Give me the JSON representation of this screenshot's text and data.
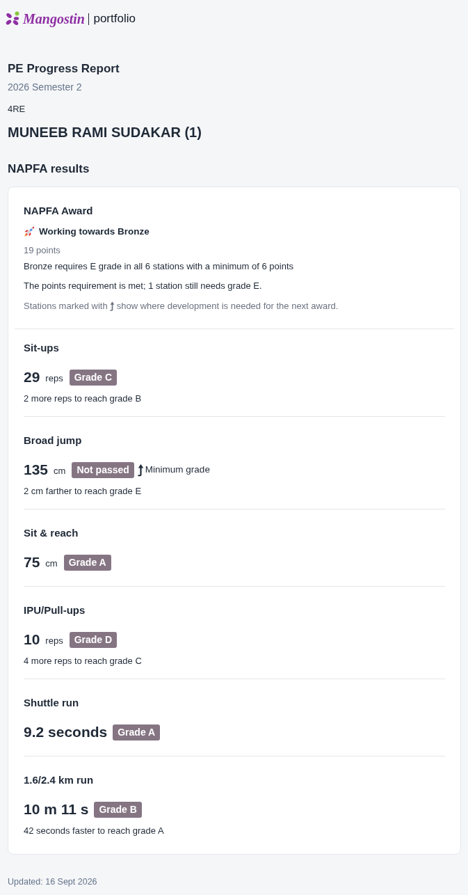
{
  "header": {
    "brand": "Mangostin",
    "product": "portfolio"
  },
  "report": {
    "title": "PE Progress Report",
    "term": "2026 Semester 2",
    "class": "4RE",
    "student": "MUNEEB RAMI SUDAKAR (1)"
  },
  "section_title": "NAPFA results",
  "award": {
    "title": "NAPFA Award",
    "status": "Working towards Bronze",
    "points": "19 points",
    "requirement": "Bronze requires E grade in all 6 stations with a minimum of 6 points",
    "progress": "The points requirement is met; 1 station still needs grade E.",
    "legend": {
      "before": "Stations marked with",
      "after": "show where development is needed for the next award."
    }
  },
  "stations": [
    {
      "name": "Sit-ups",
      "value": "29",
      "unit": "reps",
      "grade": "Grade C",
      "development_needed": false,
      "hint": "2 more reps to reach grade B"
    },
    {
      "name": "Broad jump",
      "value": "135",
      "unit": "cm",
      "grade": "Not passed",
      "development_needed": true,
      "development_label": "Minimum grade",
      "hint": "2 cm farther to reach grade E"
    },
    {
      "name": "Sit & reach",
      "value": "75",
      "unit": "cm",
      "grade": "Grade A",
      "development_needed": false
    },
    {
      "name": "IPU/Pull-ups",
      "value": "10",
      "unit": "reps",
      "grade": "Grade D",
      "development_needed": false,
      "hint": "4 more reps to reach grade C"
    },
    {
      "name": "Shuttle run",
      "value": "9.2 seconds",
      "grade": "Grade A",
      "development_needed": false
    },
    {
      "name": "1.6/2.4 km run",
      "value": "10 m 11 s",
      "grade": "Grade B",
      "development_needed": false,
      "hint": "42 seconds faster to reach grade A"
    }
  ],
  "footer": "Updated: 16 Sept 2026"
}
